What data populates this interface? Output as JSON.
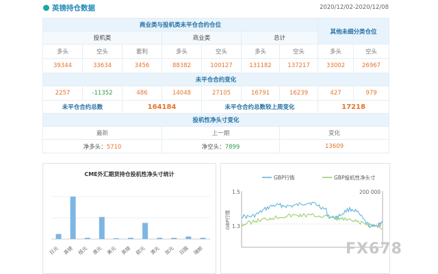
{
  "header": {
    "title": "英镑持仓数据",
    "date_range": "2020/12/02-2020/12/08"
  },
  "table": {
    "title": "商业类与投机类未平仓合约仓位",
    "other_title": "其他未细分类仓位",
    "groups": [
      "投机类",
      "商业类",
      "总计"
    ],
    "labels": [
      "多头",
      "空头",
      "套利",
      "多头",
      "空头",
      "多头",
      "空头",
      "多头",
      "空头"
    ],
    "values": [
      "39344",
      "33634",
      "3456",
      "88382",
      "100127",
      "131182",
      "137217",
      "33002",
      "26967"
    ],
    "change_title": "未平仓合约变化",
    "changes": [
      "2257",
      "-11352",
      "486",
      "14048",
      "27105",
      "16791",
      "16239",
      "427",
      "979"
    ],
    "total_label": "未平仓合约总数",
    "total_value": "164184",
    "weekly_label": "未平仓合约总数较上周变化",
    "weekly_value": "17218",
    "spec_title": "投机性净头寸变化",
    "spec_headers": [
      "最新",
      "上一期",
      "变化"
    ],
    "latest_label": "净多头：",
    "latest_value": "5710",
    "prev_label": "净空头：",
    "prev_value": "7899",
    "delta_value": "13609"
  },
  "chart_data": [
    {
      "type": "bar",
      "title": "CME外汇期货持仓投机性净头寸统计",
      "categories": [
        "日元",
        "英镑",
        "纽元",
        "澳元",
        "美元",
        "英镑",
        "欧元",
        "澳元",
        "加元",
        "日圆",
        "瑞郎"
      ],
      "values": [
        0.12,
        1.0,
        0.03,
        0.52,
        0.02,
        0.03,
        0.38,
        0.03,
        0.03,
        0.06,
        0.03
      ],
      "color": "#7db6e4"
    },
    {
      "type": "line",
      "series": [
        {
          "name": "GBP行情",
          "color": "#62b3dc"
        },
        {
          "name": "GBP投机性净头寸",
          "color": "#98cf6e"
        }
      ],
      "left_ticks": [
        "1.5",
        "1.3"
      ],
      "right_ticks": [
        "200 000",
        "0"
      ],
      "ylabel": "GBP行情"
    }
  ],
  "watermark": "FX678"
}
